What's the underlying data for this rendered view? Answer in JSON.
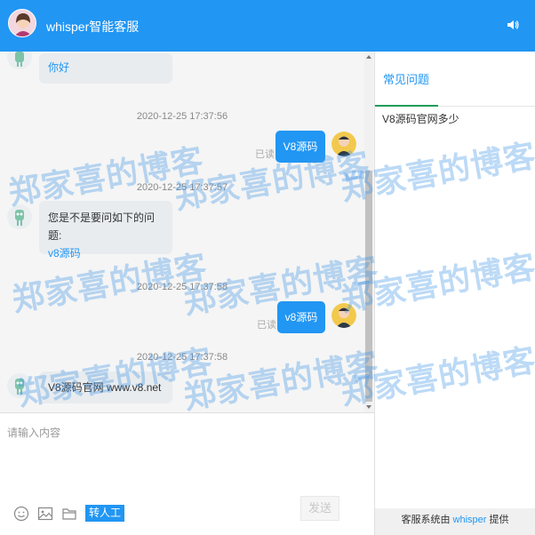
{
  "header": {
    "title": "whisper智能客服"
  },
  "messages": {
    "first_reply": "你好",
    "time1": "2020-12-25 17:37:56",
    "mine1": "V8源码",
    "read1": "已读",
    "time2": "2020-12-25 17:37:57",
    "bot2_line1": "您是不是要问如下的问题:",
    "bot2_link": "v8源码",
    "time3": "2020-12-25 17:37:58",
    "mine2": "v8源码",
    "read2": "已读",
    "time4": "2020-12-25 17:37:58",
    "bot4_text": "V8源码官网 www.v8.net"
  },
  "input": {
    "placeholder": "请输入内容"
  },
  "toolbar": {
    "transfer_label": "转人工",
    "send_label": "发送"
  },
  "sidebar": {
    "tab_label": "常见问题",
    "faq_items": [
      "V8源码官网多少"
    ],
    "powered_prefix": "客服系统由",
    "powered_link": "whisper",
    "powered_suffix": "提供"
  },
  "watermark": {
    "text": "郑家喜的博客"
  },
  "colors": {
    "primary": "#2196f3",
    "tab_underline": "#1e9d5a"
  }
}
